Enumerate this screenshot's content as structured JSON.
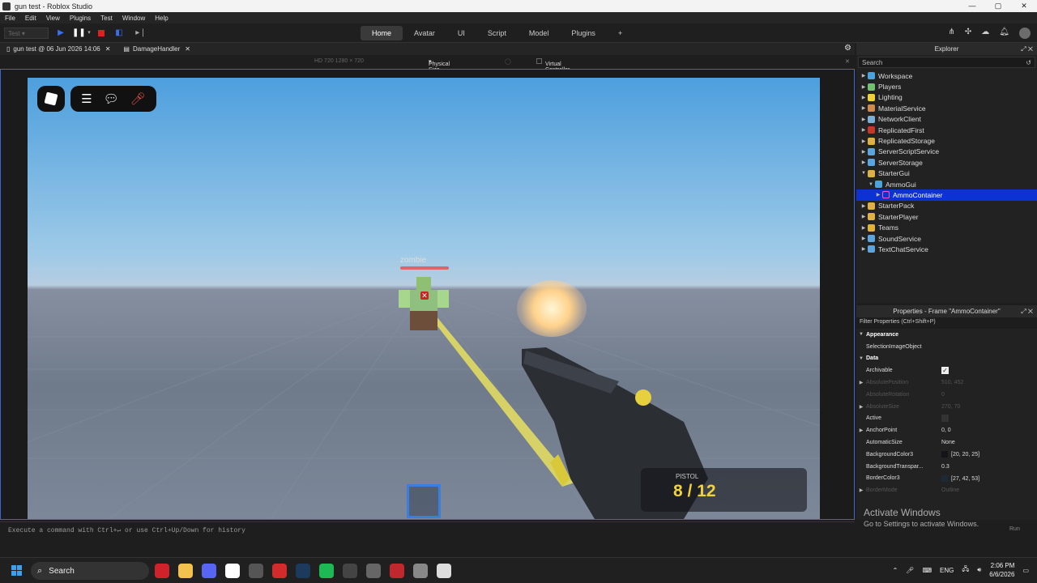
{
  "window": {
    "title": "gun test - Roblox Studio",
    "controls": [
      "—",
      "▢",
      "✕"
    ]
  },
  "menu": [
    "File",
    "Edit",
    "View",
    "Plugins",
    "Test",
    "Window",
    "Help"
  ],
  "ribbon": {
    "test_select": "Test",
    "tabs": [
      "Home",
      "Avatar",
      "UI",
      "Script",
      "Model",
      "Plugins",
      "+"
    ],
    "active_tab": "Home"
  },
  "doc_tabs": [
    {
      "label": "gun test @ 06 Jun 2026 14:06"
    },
    {
      "label": "DamageHandler"
    }
  ],
  "viewport_bar": {
    "resolution": "HD 720   1280 × 720",
    "size_mode": "Physical Size",
    "virtual_controller": "Virtual Controller"
  },
  "game": {
    "enemy_name": "zombie",
    "weapon_label": "PISTOL",
    "ammo_count": "8 / 12",
    "ammo_fraction": 0.6667
  },
  "command_bar": {
    "placeholder": "Execute a command with Ctrl+↵ or use Ctrl+Up/Down for history"
  },
  "explorer": {
    "title": "Explorer",
    "search_placeholder": "Search",
    "items": [
      {
        "label": "Workspace",
        "icon": "globe-icon",
        "color": "#4aa3df",
        "expanded": false,
        "level": 0
      },
      {
        "label": "Players",
        "icon": "players-icon",
        "color": "#6fc36f",
        "expanded": false,
        "level": 0
      },
      {
        "label": "Lighting",
        "icon": "bulb-icon",
        "color": "#f0d040",
        "expanded": false,
        "level": 0
      },
      {
        "label": "MaterialService",
        "icon": "material-icon",
        "color": "#d08a4a",
        "expanded": false,
        "level": 0
      },
      {
        "label": "NetworkClient",
        "icon": "network-icon",
        "color": "#7ab0d8",
        "expanded": false,
        "level": 0
      },
      {
        "label": "ReplicatedFirst",
        "icon": "folder-icon",
        "color": "#c0392b",
        "expanded": false,
        "level": 0
      },
      {
        "label": "ReplicatedStorage",
        "icon": "folder-icon",
        "color": "#e0b040",
        "expanded": false,
        "level": 0
      },
      {
        "label": "ServerScriptService",
        "icon": "script-service-icon",
        "color": "#5aa5e0",
        "expanded": false,
        "level": 0
      },
      {
        "label": "ServerStorage",
        "icon": "storage-icon",
        "color": "#5aa5e0",
        "expanded": false,
        "level": 0
      },
      {
        "label": "StarterGui",
        "icon": "gui-icon",
        "color": "#e0b040",
        "expanded": true,
        "level": 0
      },
      {
        "label": "AmmoGui",
        "icon": "screengui-icon",
        "color": "#4aa3df",
        "expanded": true,
        "level": 1
      },
      {
        "label": "AmmoContainer",
        "icon": "frame-icon",
        "color": "#ff5ad0",
        "expanded": false,
        "level": 2,
        "selected": true
      },
      {
        "label": "StarterPack",
        "icon": "pack-icon",
        "color": "#e0b040",
        "expanded": false,
        "level": 0
      },
      {
        "label": "StarterPlayer",
        "icon": "player-icon",
        "color": "#e0b040",
        "expanded": false,
        "level": 0
      },
      {
        "label": "Teams",
        "icon": "teams-icon",
        "color": "#e0b040",
        "expanded": false,
        "level": 0
      },
      {
        "label": "SoundService",
        "icon": "sound-icon",
        "color": "#5aa5e0",
        "expanded": false,
        "level": 0
      },
      {
        "label": "TextChatService",
        "icon": "chat-icon",
        "color": "#5aa5e0",
        "expanded": false,
        "level": 0
      }
    ]
  },
  "properties": {
    "title": "Properties - Frame \"AmmoContainer\"",
    "filter": "Filter Properties (Ctrl+Shift+P)",
    "rows": [
      {
        "kind": "section",
        "label": "Appearance"
      },
      {
        "kind": "prop",
        "label": "SelectionImageObject",
        "value": ""
      },
      {
        "kind": "section",
        "label": "Data"
      },
      {
        "kind": "check",
        "label": "Archivable",
        "checked": true
      },
      {
        "kind": "prop",
        "label": "AbsolutePosition",
        "value": "510, 452",
        "dim": true,
        "expand": true
      },
      {
        "kind": "prop",
        "label": "AbsoluteRotation",
        "value": "0",
        "dim": true
      },
      {
        "kind": "prop",
        "label": "AbsoluteSize",
        "value": "270, 70",
        "dim": true,
        "expand": true
      },
      {
        "kind": "check",
        "label": "Active",
        "checked": false
      },
      {
        "kind": "prop",
        "label": "AnchorPoint",
        "value": "0, 0",
        "expand": true
      },
      {
        "kind": "prop",
        "label": "AutomaticSize",
        "value": "None"
      },
      {
        "kind": "color",
        "label": "BackgroundColor3",
        "value": "[20, 20, 25]",
        "color": "#141419"
      },
      {
        "kind": "prop",
        "label": "BackgroundTranspar...",
        "value": "0.3"
      },
      {
        "kind": "color",
        "label": "BorderColor3",
        "value": "[27, 42, 53]",
        "color": "#1b2a35"
      },
      {
        "kind": "prop",
        "label": "BorderMode",
        "value": "Outline",
        "dim": true,
        "expand": true
      }
    ]
  },
  "watermark": {
    "line1": "Activate Windows",
    "line2": "Go to Settings to activate Windows.",
    "run": "Run"
  },
  "taskbar": {
    "search": "Search",
    "apps": [
      {
        "name": "opera-icon",
        "color": "#d0222a"
      },
      {
        "name": "file-explorer-icon",
        "color": "#f2c14e"
      },
      {
        "name": "discord-icon",
        "color": "#5865f2"
      },
      {
        "name": "roblox-studio-icon",
        "color": "#ffffff"
      },
      {
        "name": "app-icon",
        "color": "#555555"
      },
      {
        "name": "app-icon-2",
        "color": "#d12b2b"
      },
      {
        "name": "steam-icon",
        "color": "#1b3a5c"
      },
      {
        "name": "spotify-icon",
        "color": "#1db954"
      },
      {
        "name": "app-icon-3",
        "color": "#444444"
      },
      {
        "name": "app-icon-4",
        "color": "#666666"
      },
      {
        "name": "app-icon-5",
        "color": "#c0282d"
      },
      {
        "name": "settings-icon",
        "color": "#888888"
      },
      {
        "name": "roblox-icon",
        "color": "#dddddd"
      }
    ],
    "language": "ENG",
    "time": "2:06 PM",
    "date": "6/6/2026"
  }
}
